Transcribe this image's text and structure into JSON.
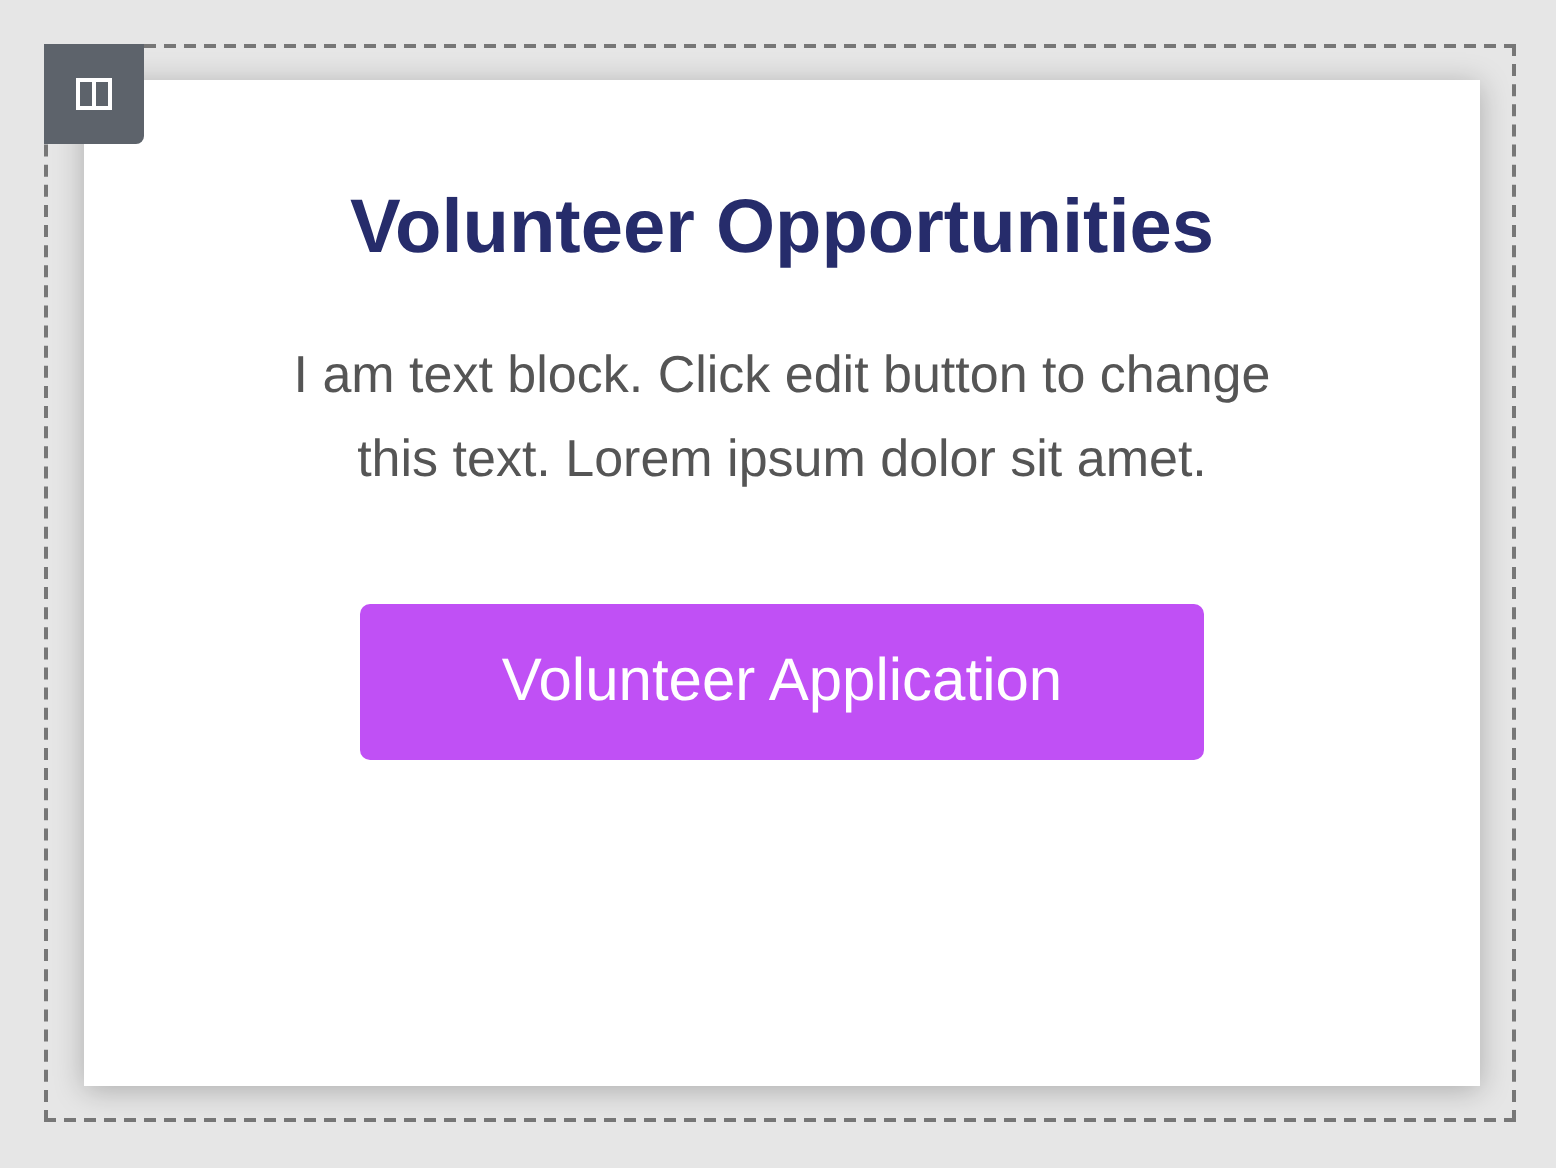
{
  "widget": {
    "title": "Volunteer Opportunities",
    "text": "I am text block. Click edit button to change this text. Lorem ipsum dolor sit amet.",
    "button": "Volunteer Application"
  }
}
